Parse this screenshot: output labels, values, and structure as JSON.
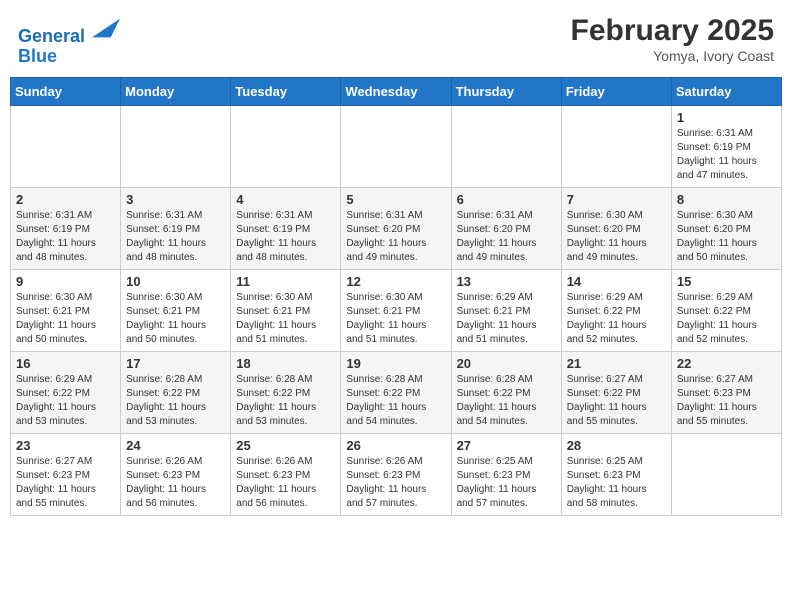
{
  "header": {
    "logo_line1": "General",
    "logo_line2": "Blue",
    "month_title": "February 2025",
    "location": "Yomya, Ivory Coast"
  },
  "days_of_week": [
    "Sunday",
    "Monday",
    "Tuesday",
    "Wednesday",
    "Thursday",
    "Friday",
    "Saturday"
  ],
  "weeks": [
    [
      {
        "day": "",
        "info": ""
      },
      {
        "day": "",
        "info": ""
      },
      {
        "day": "",
        "info": ""
      },
      {
        "day": "",
        "info": ""
      },
      {
        "day": "",
        "info": ""
      },
      {
        "day": "",
        "info": ""
      },
      {
        "day": "1",
        "info": "Sunrise: 6:31 AM\nSunset: 6:19 PM\nDaylight: 11 hours and 47 minutes."
      }
    ],
    [
      {
        "day": "2",
        "info": "Sunrise: 6:31 AM\nSunset: 6:19 PM\nDaylight: 11 hours and 48 minutes."
      },
      {
        "day": "3",
        "info": "Sunrise: 6:31 AM\nSunset: 6:19 PM\nDaylight: 11 hours and 48 minutes."
      },
      {
        "day": "4",
        "info": "Sunrise: 6:31 AM\nSunset: 6:19 PM\nDaylight: 11 hours and 48 minutes."
      },
      {
        "day": "5",
        "info": "Sunrise: 6:31 AM\nSunset: 6:20 PM\nDaylight: 11 hours and 49 minutes."
      },
      {
        "day": "6",
        "info": "Sunrise: 6:31 AM\nSunset: 6:20 PM\nDaylight: 11 hours and 49 minutes."
      },
      {
        "day": "7",
        "info": "Sunrise: 6:30 AM\nSunset: 6:20 PM\nDaylight: 11 hours and 49 minutes."
      },
      {
        "day": "8",
        "info": "Sunrise: 6:30 AM\nSunset: 6:20 PM\nDaylight: 11 hours and 50 minutes."
      }
    ],
    [
      {
        "day": "9",
        "info": "Sunrise: 6:30 AM\nSunset: 6:21 PM\nDaylight: 11 hours and 50 minutes."
      },
      {
        "day": "10",
        "info": "Sunrise: 6:30 AM\nSunset: 6:21 PM\nDaylight: 11 hours and 50 minutes."
      },
      {
        "day": "11",
        "info": "Sunrise: 6:30 AM\nSunset: 6:21 PM\nDaylight: 11 hours and 51 minutes."
      },
      {
        "day": "12",
        "info": "Sunrise: 6:30 AM\nSunset: 6:21 PM\nDaylight: 11 hours and 51 minutes."
      },
      {
        "day": "13",
        "info": "Sunrise: 6:29 AM\nSunset: 6:21 PM\nDaylight: 11 hours and 51 minutes."
      },
      {
        "day": "14",
        "info": "Sunrise: 6:29 AM\nSunset: 6:22 PM\nDaylight: 11 hours and 52 minutes."
      },
      {
        "day": "15",
        "info": "Sunrise: 6:29 AM\nSunset: 6:22 PM\nDaylight: 11 hours and 52 minutes."
      }
    ],
    [
      {
        "day": "16",
        "info": "Sunrise: 6:29 AM\nSunset: 6:22 PM\nDaylight: 11 hours and 53 minutes."
      },
      {
        "day": "17",
        "info": "Sunrise: 6:28 AM\nSunset: 6:22 PM\nDaylight: 11 hours and 53 minutes."
      },
      {
        "day": "18",
        "info": "Sunrise: 6:28 AM\nSunset: 6:22 PM\nDaylight: 11 hours and 53 minutes."
      },
      {
        "day": "19",
        "info": "Sunrise: 6:28 AM\nSunset: 6:22 PM\nDaylight: 11 hours and 54 minutes."
      },
      {
        "day": "20",
        "info": "Sunrise: 6:28 AM\nSunset: 6:22 PM\nDaylight: 11 hours and 54 minutes."
      },
      {
        "day": "21",
        "info": "Sunrise: 6:27 AM\nSunset: 6:22 PM\nDaylight: 11 hours and 55 minutes."
      },
      {
        "day": "22",
        "info": "Sunrise: 6:27 AM\nSunset: 6:23 PM\nDaylight: 11 hours and 55 minutes."
      }
    ],
    [
      {
        "day": "23",
        "info": "Sunrise: 6:27 AM\nSunset: 6:23 PM\nDaylight: 11 hours and 55 minutes."
      },
      {
        "day": "24",
        "info": "Sunrise: 6:26 AM\nSunset: 6:23 PM\nDaylight: 11 hours and 56 minutes."
      },
      {
        "day": "25",
        "info": "Sunrise: 6:26 AM\nSunset: 6:23 PM\nDaylight: 11 hours and 56 minutes."
      },
      {
        "day": "26",
        "info": "Sunrise: 6:26 AM\nSunset: 6:23 PM\nDaylight: 11 hours and 57 minutes."
      },
      {
        "day": "27",
        "info": "Sunrise: 6:25 AM\nSunset: 6:23 PM\nDaylight: 11 hours and 57 minutes."
      },
      {
        "day": "28",
        "info": "Sunrise: 6:25 AM\nSunset: 6:23 PM\nDaylight: 11 hours and 58 minutes."
      },
      {
        "day": "",
        "info": ""
      }
    ]
  ]
}
